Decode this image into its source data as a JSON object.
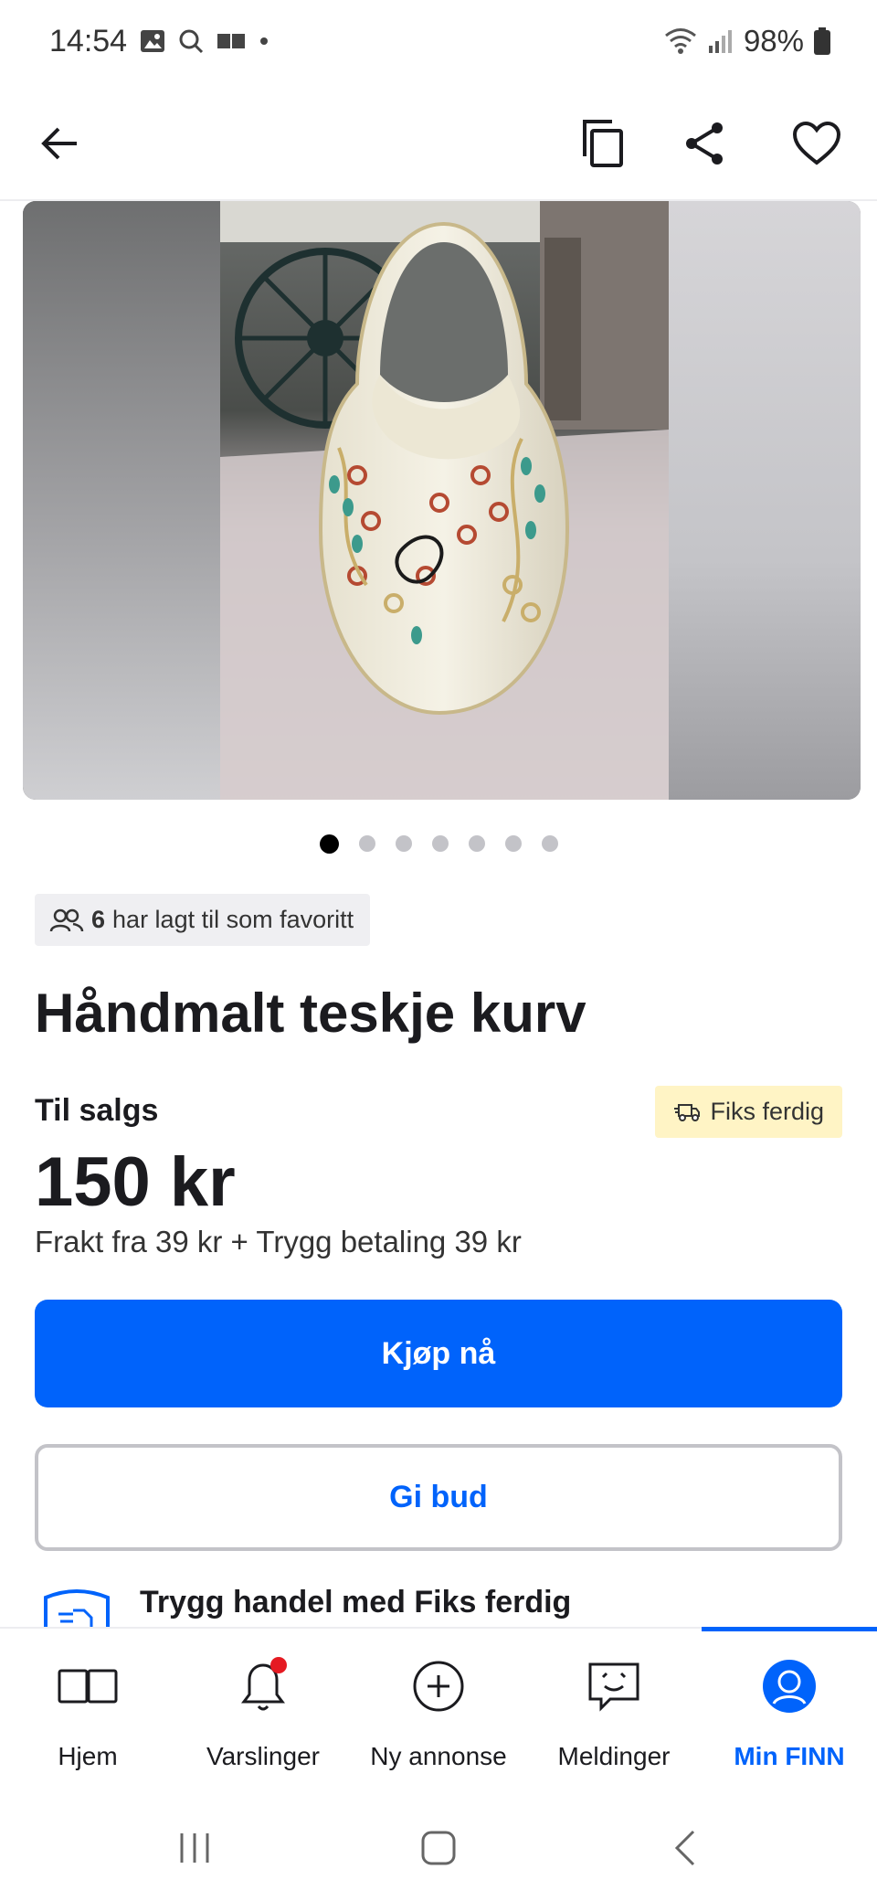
{
  "status_bar": {
    "time": "14:54",
    "battery": "98%"
  },
  "app_bar": {
    "back_icon": "arrow-left-icon",
    "copy_icon": "copy-icon",
    "share_icon": "share-icon",
    "favorite_icon": "heart-icon"
  },
  "carousel": {
    "total_images": 7,
    "active_index": 0
  },
  "favorites": {
    "count": "6",
    "text": "har lagt til som favoritt"
  },
  "listing": {
    "title": "Håndmalt teskje kurv",
    "sale_label": "Til salgs",
    "badge": "Fiks ferdig",
    "price": "150 kr",
    "shipping": "Frakt fra 39 kr + Trygg betaling 39 kr"
  },
  "actions": {
    "buy_now": "Kjøp nå",
    "make_offer": "Gi bud"
  },
  "safe_trade": {
    "title": "Trygg handel med Fiks ferdig"
  },
  "bottom_nav": {
    "items": [
      {
        "label": "Hjem",
        "icon": "book-open-icon"
      },
      {
        "label": "Varslinger",
        "icon": "bell-icon"
      },
      {
        "label": "Ny annonse",
        "icon": "plus-circle-icon"
      },
      {
        "label": "Meldinger",
        "icon": "chat-smile-icon"
      },
      {
        "label": "Min FINN",
        "icon": "user-circle-icon"
      }
    ],
    "active": "Min FINN"
  },
  "colors": {
    "primary": "#0063fb",
    "badge_bg": "#fff4c5",
    "notification_dot": "#e51a22"
  }
}
